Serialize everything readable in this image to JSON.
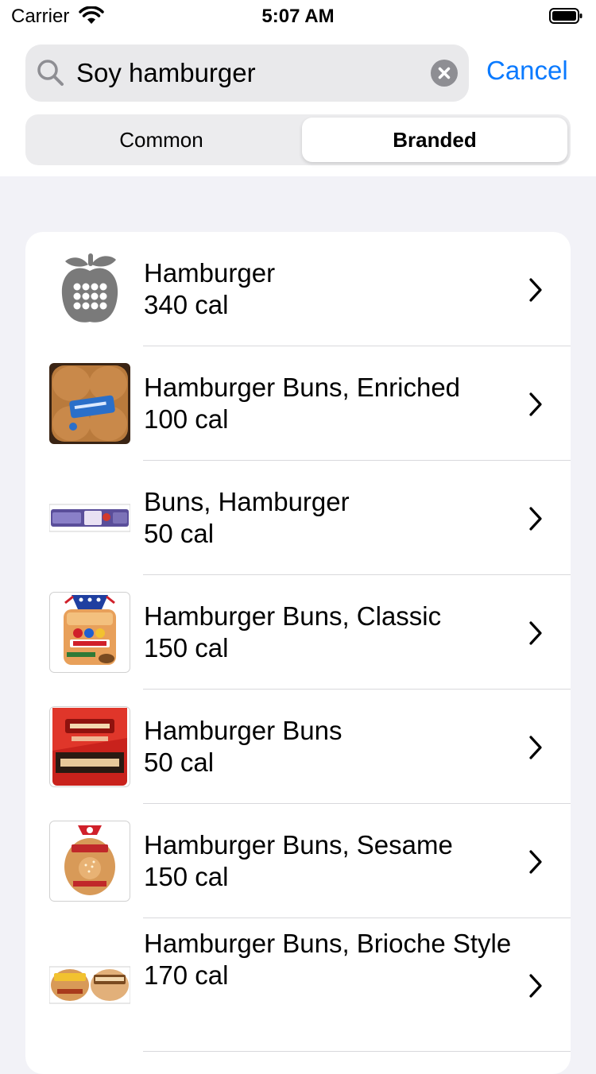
{
  "status_bar": {
    "carrier": "Carrier",
    "time": "5:07 AM"
  },
  "search": {
    "query": "Soy hamburger",
    "cancel_label": "Cancel"
  },
  "segments": {
    "common": "Common",
    "branded": "Branded",
    "selected": "Branded"
  },
  "colors": {
    "accent": "#0a7aff",
    "background": "#f2f2f7"
  },
  "results": [
    {
      "name": "Hamburger",
      "calories": "340 cal",
      "icon": "generic-food-calculator-icon"
    },
    {
      "name": "Hamburger Buns, Enriched",
      "calories": "100 cal",
      "icon": "product-photo"
    },
    {
      "name": "Buns, Hamburger",
      "calories": "50 cal",
      "icon": "product-photo"
    },
    {
      "name": "Hamburger Buns, Classic",
      "calories": "150 cal",
      "icon": "product-photo"
    },
    {
      "name": "Hamburger Buns",
      "calories": "50 cal",
      "icon": "product-photo"
    },
    {
      "name": "Hamburger Buns, Sesame",
      "calories": "150 cal",
      "icon": "product-photo"
    },
    {
      "name": "Hamburger Buns, Brioche Style",
      "calories": "170 cal",
      "icon": "product-photo"
    }
  ]
}
